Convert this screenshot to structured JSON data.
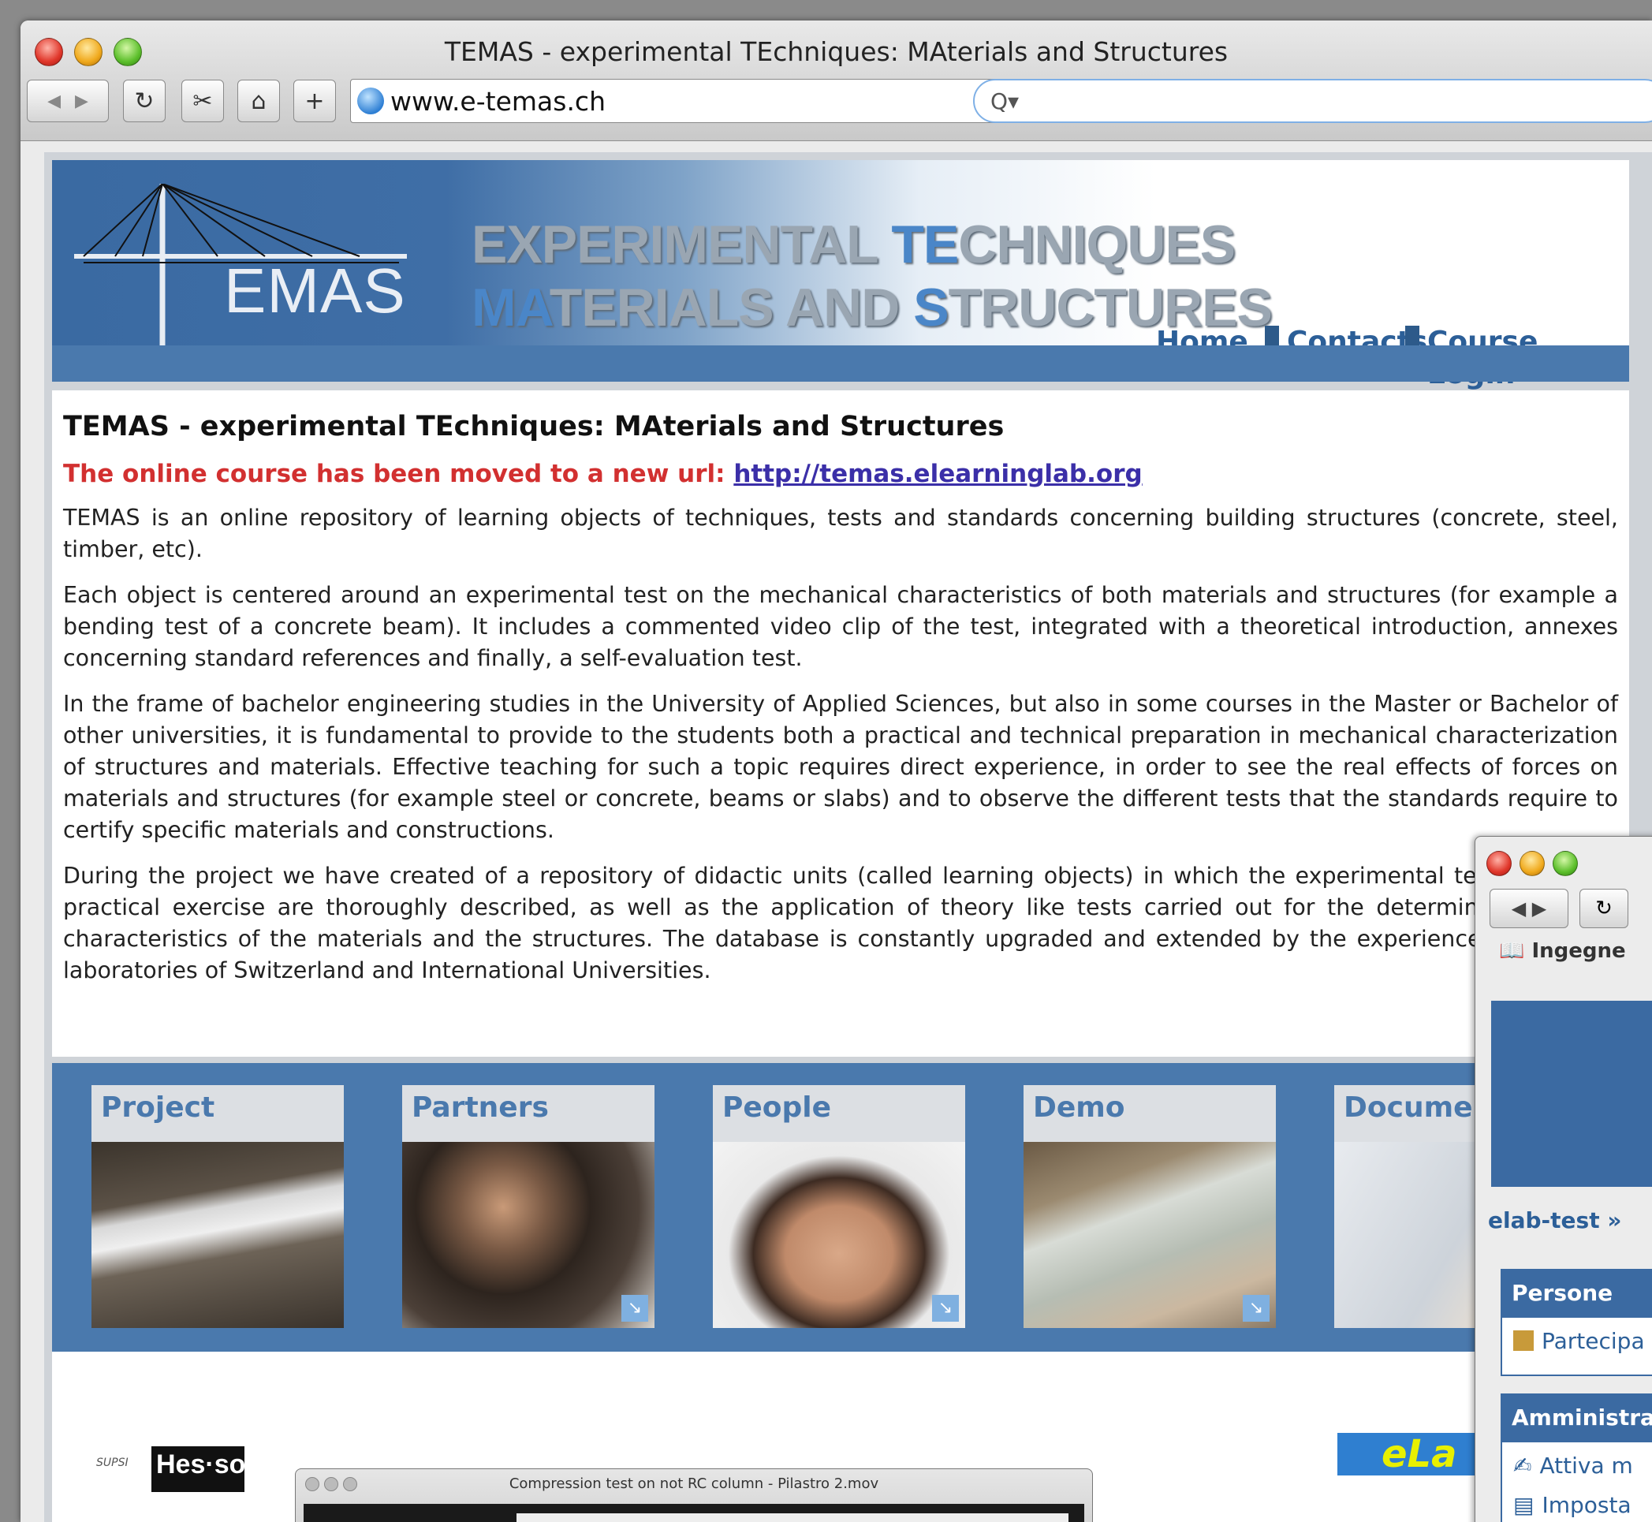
{
  "browser": {
    "window_title": "TEMAS - experimental TEchniques: MAterials and Structures",
    "url": "www.e-temas.ch",
    "buttons": {
      "back": "◀",
      "forward": "▶",
      "reload": "↻",
      "snip": "✂",
      "home": "⌂",
      "add": "+"
    },
    "search_icon": "Q▾"
  },
  "banner": {
    "logo_text": "EMAS",
    "heading_line1_a": "EXPERIMENTAL ",
    "heading_line1_b": "TE",
    "heading_line1_c": "CHNIQUES",
    "heading_line2_a": "MA",
    "heading_line2_b": "TERIALS AND ",
    "heading_line2_c": "S",
    "heading_line2_d": "TRUCTURES",
    "nav": [
      "Home",
      "Contacts",
      "Course Login"
    ]
  },
  "main": {
    "title": "TEMAS - experimental TEchniques: MAterials and Structures",
    "notice": "The online course has been moved to a new url: ",
    "notice_link": "http://temas.elearninglab.org",
    "paragraphs": [
      "TEMAS is an online repository of learning objects of techniques, tests and standards concerning building structures (concrete, steel, timber, etc).",
      "Each object is centered around an experimental test on the mechanical characteristics of both materials and structures (for example a bending test of a concrete beam). It includes a commented video clip of the test, integrated with a theoretical introduction, annexes concerning standard references and finally, a self-evaluation test.",
      "In the frame of bachelor engineering studies in the University of Applied Sciences, but also in some courses in the Master or Bachelor of other universities, it is fundamental to provide to the students both a practical and technical preparation in mechanical characterization of structures and materials. Effective teaching for such a topic requires direct experience, in order to see the real effects of forces on materials and structures (for example steel or concrete, beams or slabs) and to observe the different tests that the standards require to certify specific materials and constructions.",
      "During the project we have created of a repository of didactic units (called learning objects) in which the experimental technique and practical exercise are thoroughly described, as well as the application of theory like tests carried out for the determination of the characteristics of the materials and the structures. The database is constantly upgraded and extended by the experiences r different laboratories of Switzerland and International Universities."
    ]
  },
  "tiles": [
    {
      "label": "Project"
    },
    {
      "label": "Partners"
    },
    {
      "label": "People"
    },
    {
      "label": "Demo"
    },
    {
      "label": "Documer"
    }
  ],
  "footer": {
    "hesso": "Hes·so",
    "supsi": "SUPSI",
    "elab": "eLa"
  },
  "video_window": {
    "title": "Compression test on not RC column - Pilastro 2.mov"
  },
  "second_window": {
    "bookmark": "Ingegne",
    "crumb": "elab-test »",
    "box1_header": "Persone",
    "box1_item": "Partecipa",
    "box2_header": "Amministraz",
    "box2_items": [
      "Attiva m",
      "Imposta"
    ]
  }
}
